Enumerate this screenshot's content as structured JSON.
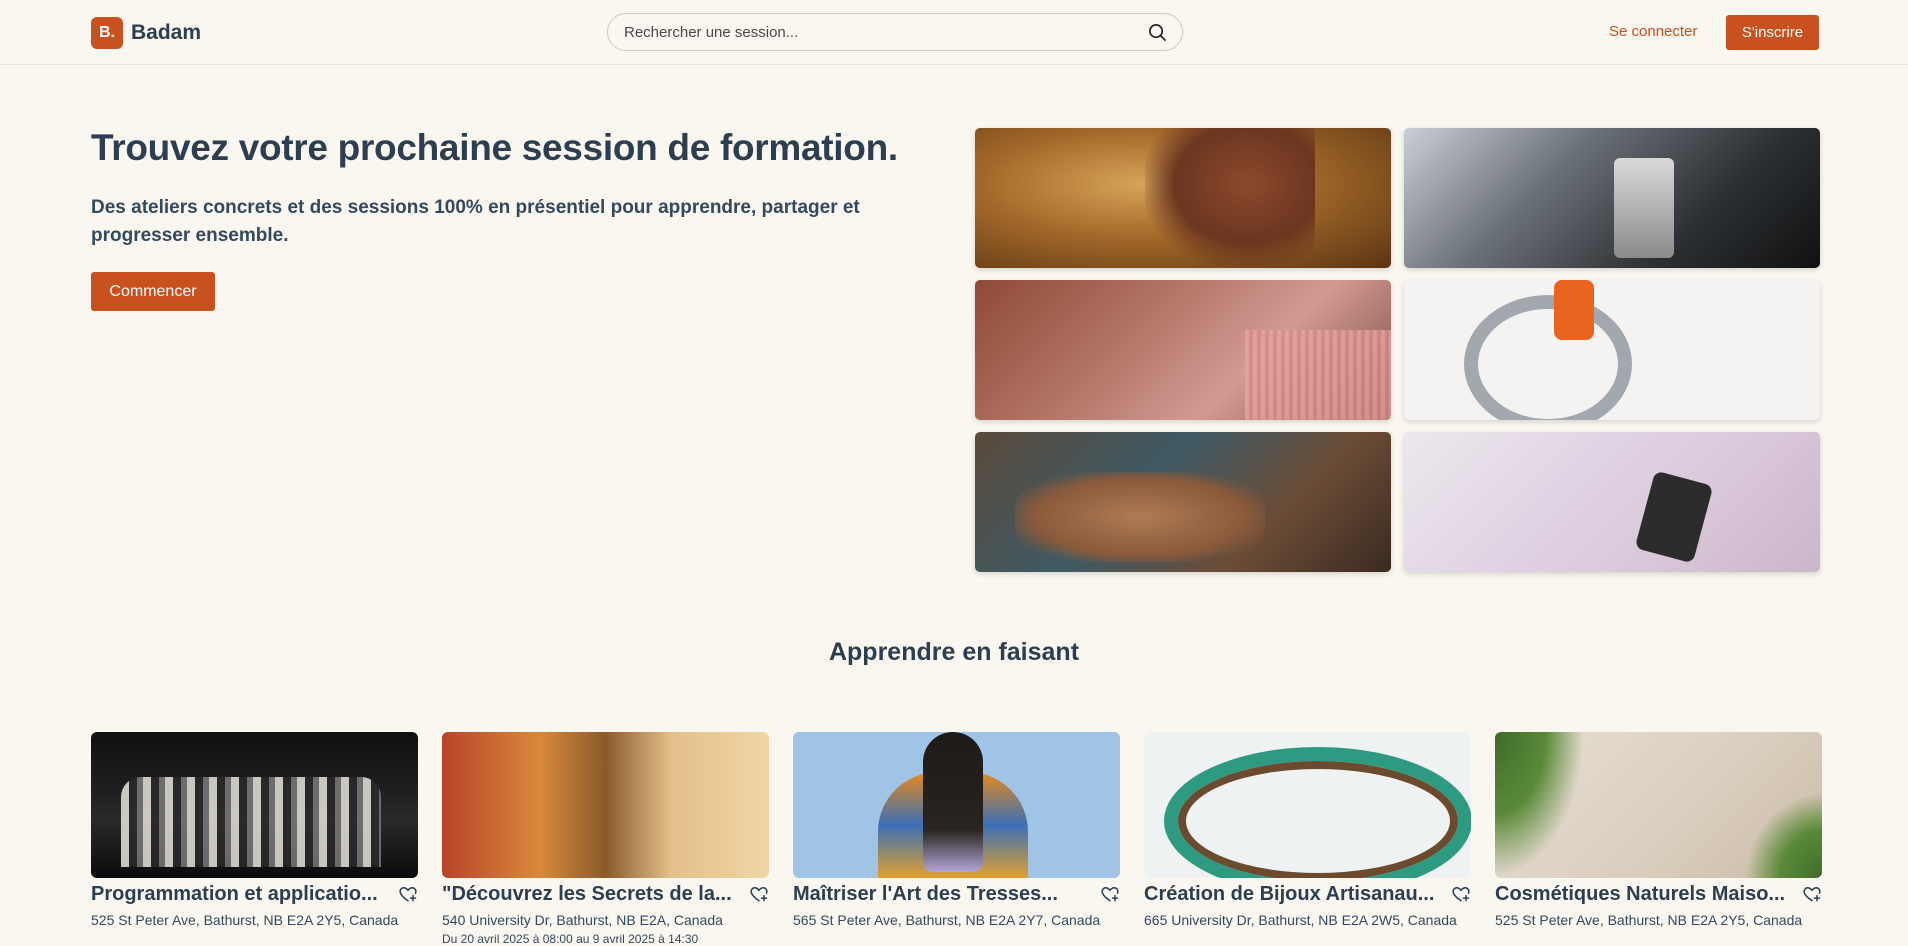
{
  "header": {
    "logo_badge": "B.",
    "logo_text": "Badam",
    "search_placeholder": "Rechercher une session...",
    "login_label": "Se connecter",
    "signup_label": "S'inscrire"
  },
  "hero": {
    "title": "Trouvez votre prochaine session de formation.",
    "subtitle": "Des ateliers concrets et des sessions 100% en présentiel pour apprendre, partager et progresser ensemble.",
    "cta_label": "Commencer"
  },
  "gallery": [
    {
      "alt": "pottery hands"
    },
    {
      "alt": "engine oil"
    },
    {
      "alt": "knitting"
    },
    {
      "alt": "sewing tools"
    },
    {
      "alt": "beading"
    },
    {
      "alt": "fabric drawing"
    }
  ],
  "section": {
    "title": "Apprendre en faisant"
  },
  "cards": [
    {
      "title": "Programmation et applicatio...",
      "address": "525 St Peter Ave, Bathurst, NB E2A 2Y5, Canada",
      "date": ""
    },
    {
      "title": "\"Découvrez les Secrets de la...",
      "address": "540 University Dr, Bathurst, NB E2A, Canada",
      "date": "Du 20 avril 2025 à 08:00 au 9 avril 2025 à 14:30"
    },
    {
      "title": "Maîtriser l'Art des Tresses...",
      "address": "565 St Peter Ave, Bathurst, NB E2A 2Y7, Canada",
      "date": ""
    },
    {
      "title": "Création de Bijoux Artisanau...",
      "address": "665 University Dr, Bathurst, NB E2A 2W5, Canada",
      "date": ""
    },
    {
      "title": "Cosmétiques Naturels Maiso...",
      "address": "525 St Peter Ave, Bathurst, NB E2A 2Y5, Canada",
      "date": ""
    }
  ],
  "colors": {
    "accent": "#c9501f",
    "background": "#faf7f0",
    "text": "#2c3e50"
  }
}
